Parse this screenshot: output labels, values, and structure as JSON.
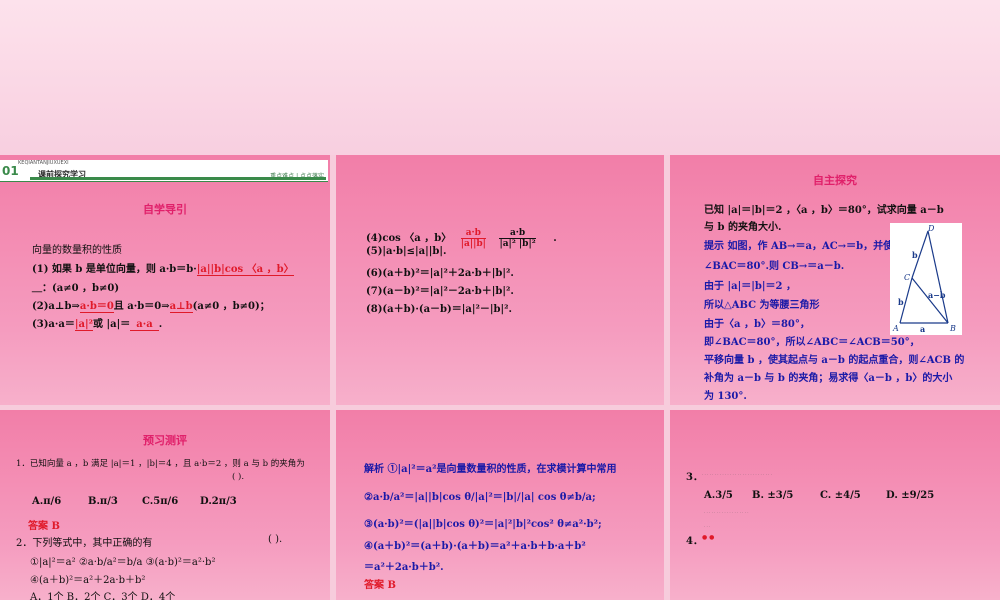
{
  "slide1": {
    "banner_num": "01",
    "banner_small": "KEQIANTANJIUXUEXI",
    "banner_title": "课前探究学习",
    "banner_right": "重点难点 | 点点落实",
    "heading": "自学导引",
    "intro": "向量的数量积的性质",
    "p1_a": "(1) 如果 b 是单位向量，则 a·b＝b·",
    "p1_fill": "|a||b|cos 〈a ，b〉",
    "p1_b": "＿：(a≠0 ，b≠0)",
    "p2_a": "(2)a⊥b⇒",
    "p2_fill1": "a·b＝0",
    "p2_b": "且 a·b＝0⇒",
    "p2_fill2": "a⊥b",
    "p2_c": "(a≠0 ，b≠0)；",
    "p3_a": "(3)a·a＝",
    "p3_fill1": "|a|²",
    "p3_b": "或 |a|＝",
    "p3_fill2": "a·a",
    "p3_c": "."
  },
  "slide2": {
    "l4_a": "(4)cos 〈a ，b〉",
    "l4_num": "a·b",
    "l4_den": "|a||b|",
    "l4_fill_num": "a·b",
    "l4_fill_den": "|a|² |b|²",
    "l5": "(5)|a·b|≤|a||b|.",
    "l6": "(6)(a＋b)²＝|a|²＋2a·b＋|b|².",
    "l7": "(7)(a－b)²＝|a|²－2a·b＋|b|².",
    "l8": "(8)(a＋b)·(a－b)＝|a|²－|b|²."
  },
  "slide3": {
    "heading": "自主探究",
    "q1": "已知 |a|＝|b|＝2 ，〈a ，b〉＝80°，试求向量 a－b",
    "q2": "与 b 的夹角大小.",
    "h1": "提示    如图，作 AB→＝a，AC→＝b，并使",
    "h2": "∠BAC＝80°.则 CB→＝a－b.",
    "h3": "由于 |a|＝|b|＝2 ，",
    "h4": "所以△ABC 为等腰三角形",
    "h5": "由于〈a ，b〉＝80°，",
    "h6": "即∠BAC＝80°，所以∠ABC＝∠ACB＝50°，",
    "h7": "平移向量 b ，使其起点与 a－b 的起点重合，则∠ACB 的",
    "h8": "补角为 a－b 与 b 的夹角；易求得〈a－b ，b〉的大小",
    "h9": "为 130°.",
    "fig_labels": [
      "D",
      "b",
      "C",
      "a−b",
      "b",
      "A",
      "a",
      "B"
    ]
  },
  "slide4": {
    "heading": "预习测评",
    "q1": "1．已知向量 a ，b 满足 |a|＝1 ，|b|＝4 ，且 a·b＝2 ，则 a 与 b 的夹角为",
    "q1_paren": "(          ).",
    "q1_opts": [
      "A.π/6",
      "B.π/3",
      "C.5π/6",
      "D.2π/3"
    ],
    "q1_ans": "答案    B",
    "q2": "2．下列等式中，其中正确的有",
    "q2_paren": "(          ).",
    "q2_items1": "①|a|²＝a²    ②a·b/a²＝b/a    ③(a·b)²＝a²·b²",
    "q2_items2": "④(a＋b)²＝a²＋2a·b＋b²",
    "q2_opts": "A．1个      B．2个      C．3个      D．4个"
  },
  "slide5": {
    "l1": "解析   ①|a|²＝a²是向量数量积的性质，在求模计算中常用",
    "l2": "②a·b/a²＝|a||b|cos θ/|a|²＝|b|/|a| cos θ≠b/a;",
    "l3": "③(a·b)²＝(|a||b|cos θ)²＝|a|²|b|²cos² θ≠a²·b²;",
    "l4": "④(a＋b)²＝(a＋b)·(a＋b)＝a²＋a·b＋b·a＋b²",
    "l5": "＝a²＋2a·b＋b².",
    "ans": "答案    B"
  },
  "slide6": {
    "q3_num": "3．",
    "q3_opts": [
      "A.3/5",
      "B. ±3/5",
      "C. ±4/5",
      "D. ±9/25"
    ],
    "q4_num": "4．"
  }
}
